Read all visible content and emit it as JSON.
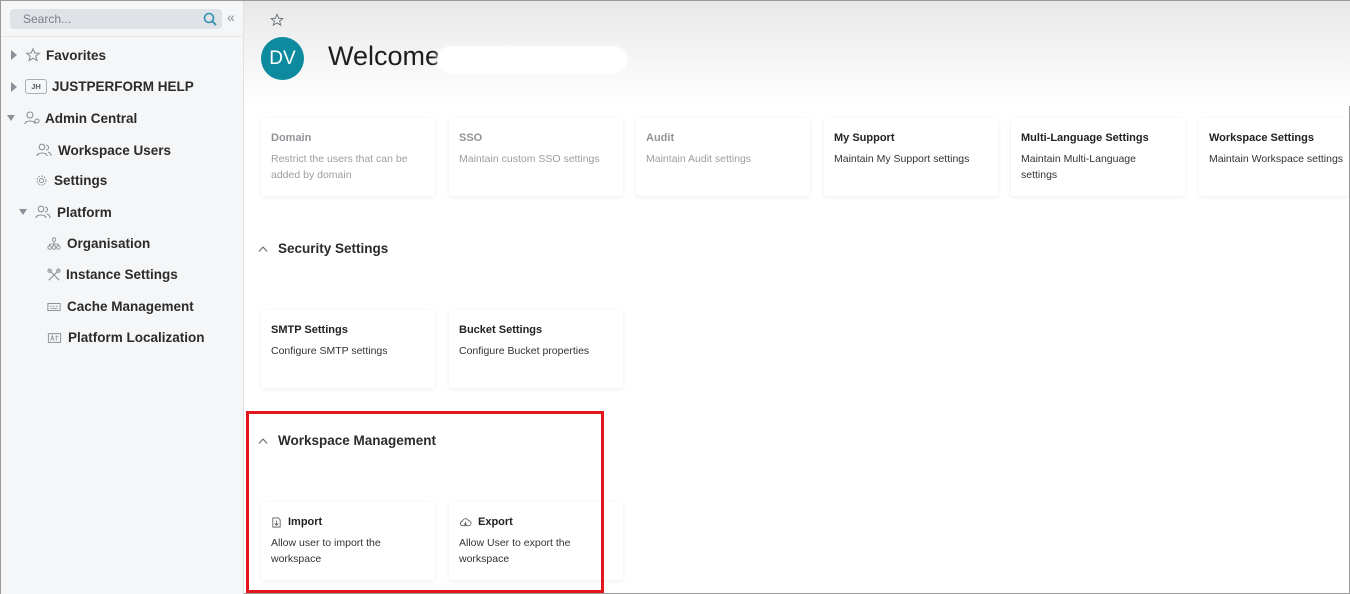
{
  "search": {
    "placeholder": "Search..."
  },
  "sidebar": {
    "items": [
      {
        "label": "Favorites"
      },
      {
        "label": "JUSTPERFORM HELP",
        "badge": "JH"
      },
      {
        "label": "Admin Central"
      },
      {
        "label": "Workspace Users"
      },
      {
        "label": "Settings"
      },
      {
        "label": "Platform"
      },
      {
        "label": "Organisation"
      },
      {
        "label": "Instance Settings"
      },
      {
        "label": "Cache Management"
      },
      {
        "label": "Platform Localization"
      }
    ]
  },
  "header": {
    "avatar_initials": "DV",
    "welcome": "Welcome"
  },
  "cards": [
    {
      "title": "Domain",
      "desc": "Restrict the users that can be added by domain"
    },
    {
      "title": "SSO",
      "desc": "Maintain custom SSO settings"
    },
    {
      "title": "Audit",
      "desc": "Maintain Audit settings"
    },
    {
      "title": "My Support",
      "desc": "Maintain My Support settings"
    },
    {
      "title": "Multi-Language Settings",
      "desc": "Maintain Multi-Language settings"
    },
    {
      "title": "Workspace Settings",
      "desc": "Maintain Workspace settings"
    }
  ],
  "security": {
    "title": "Security Settings",
    "cards": [
      {
        "title": "SMTP Settings",
        "desc": "Configure SMTP settings"
      },
      {
        "title": "Bucket Settings",
        "desc": "Configure Bucket properties"
      }
    ]
  },
  "workspace_mgmt": {
    "title": "Workspace Management",
    "cards": [
      {
        "title": "Import",
        "desc": "Allow user to import the workspace"
      },
      {
        "title": "Export",
        "desc": "Allow User to export the workspace"
      }
    ]
  },
  "colors": {
    "avatar": "#0e8a9f",
    "highlight": "#e3171b"
  }
}
